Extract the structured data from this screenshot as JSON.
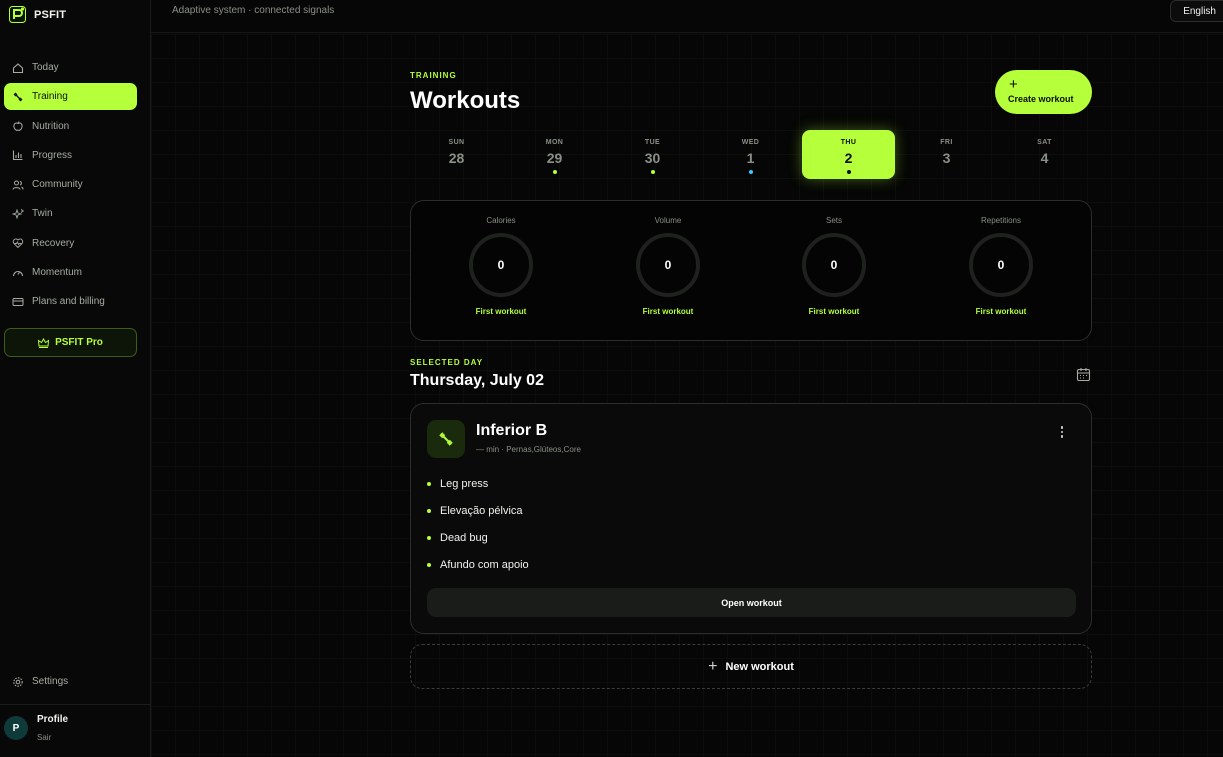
{
  "brand": {
    "name": "PSFIT"
  },
  "sidebar": {
    "items": [
      {
        "label": "Today",
        "icon": "home-icon"
      },
      {
        "label": "Training",
        "icon": "dumbbell-icon",
        "active": true
      },
      {
        "label": "Nutrition",
        "icon": "apple-icon"
      },
      {
        "label": "Progress",
        "icon": "bar-chart-icon"
      },
      {
        "label": "Community",
        "icon": "users-icon"
      },
      {
        "label": "Twin",
        "icon": "sparkles-icon"
      },
      {
        "label": "Recovery",
        "icon": "heart-pulse-icon"
      },
      {
        "label": "Momentum",
        "icon": "gauge-icon"
      },
      {
        "label": "Plans and billing",
        "icon": "credit-card-icon"
      }
    ],
    "pro_label": "PSFIT Pro",
    "settings_label": "Settings",
    "profile": {
      "initial": "P",
      "name": "Profile",
      "action": "Sair"
    }
  },
  "topbar": {
    "subtitle": "Adaptive system · connected signals",
    "language": "English"
  },
  "page": {
    "eyebrow": "TRAINING",
    "title": "Workouts",
    "create_label": "Create workout",
    "create_icon": "+"
  },
  "week": [
    {
      "name": "SUN",
      "date": "28",
      "dot": null
    },
    {
      "name": "MON",
      "date": "29",
      "dot": "#b6ff3b"
    },
    {
      "name": "TUE",
      "date": "30",
      "dot": "#b6ff3b"
    },
    {
      "name": "WED",
      "date": "1",
      "dot": "#3bc8ff"
    },
    {
      "name": "THU",
      "date": "2",
      "dot": "#0b0f06",
      "active": true
    },
    {
      "name": "FRI",
      "date": "3",
      "dot": null
    },
    {
      "name": "SAT",
      "date": "4",
      "dot": null
    }
  ],
  "stats": [
    {
      "label": "Calories",
      "value": "0",
      "note": "First workout"
    },
    {
      "label": "Volume",
      "value": "0",
      "note": "First workout"
    },
    {
      "label": "Sets",
      "value": "0",
      "note": "First workout"
    },
    {
      "label": "Repetitions",
      "value": "0",
      "note": "First workout"
    }
  ],
  "selected": {
    "eyebrow": "SELECTED DAY",
    "title": "Thursday, July 02"
  },
  "workout": {
    "title": "Inferior B",
    "meta": "— min · Pernas,Glúteos,Core",
    "exercises": [
      "Leg press",
      "Elevação pélvica",
      "Dead bug",
      "Afundo com apoio"
    ],
    "open_label": "Open workout"
  },
  "new_workout": {
    "label": "New workout",
    "icon": "+"
  },
  "colors": {
    "accent": "#b6ff3b",
    "background": "#050605",
    "card": "#090a09"
  }
}
